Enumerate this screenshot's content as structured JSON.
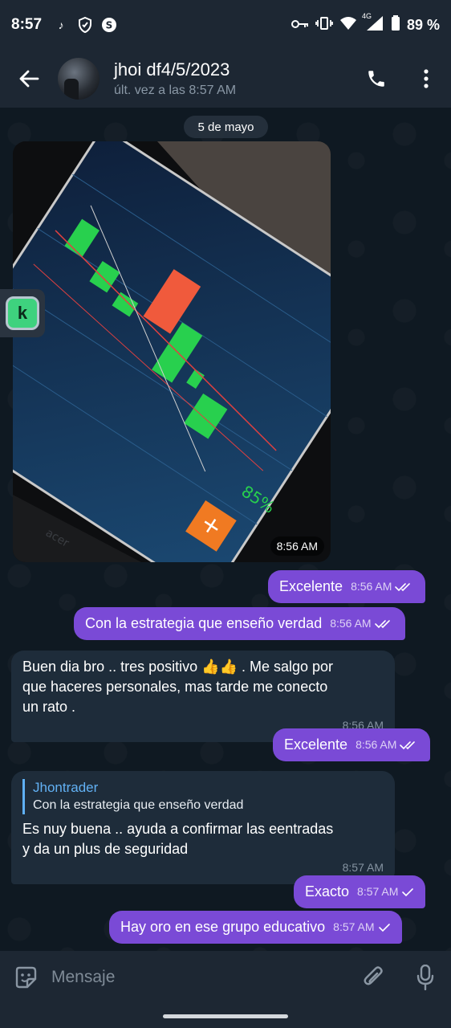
{
  "status_bar": {
    "time": "8:57",
    "network": "4G",
    "battery": "89 %"
  },
  "header": {
    "chat_name": "jhoi df4/5/2023",
    "last_seen": "últ. vez a las 8:57 AM"
  },
  "chat": {
    "date_label": "5 de mayo",
    "photo_time": "8:56 AM",
    "messages": [
      {
        "dir": "out",
        "text": "Excelente",
        "time": "8:56 AM"
      },
      {
        "dir": "out",
        "text": "Con la estrategia que enseño verdad",
        "time": "8:56 AM"
      },
      {
        "dir": "in",
        "text_line1": "Buen dia bro .. tres positivo 👍👍 . Me salgo por",
        "text_line2": "que haceres personales, mas tarde me conecto",
        "text_line3": "un rato .",
        "time": "8:56 AM"
      },
      {
        "dir": "out",
        "text": "Excelente",
        "time": "8:56 AM"
      },
      {
        "dir": "in",
        "reply_name": "Jhontrader",
        "reply_text": "Con la estrategia que enseño verdad",
        "text_line1": "Es nuy buena .. ayuda a confirmar las eentradas",
        "text_line2": "y da un plus de seguridad",
        "time": "8:57 AM"
      },
      {
        "dir": "out",
        "text": "Exacto",
        "time": "8:57 AM"
      },
      {
        "dir": "out",
        "text": "Hay oro en ese grupo educativo",
        "time": "8:57 AM"
      }
    ]
  },
  "input": {
    "placeholder": "Mensaje"
  },
  "photo_labels": {
    "pct": "85%",
    "plus": "+",
    "brand": "acer"
  },
  "k_app_letter": "k",
  "colors": {
    "outgoing_bubble": "#7a4ad6",
    "incoming_bubble": "#1e2c3a",
    "header_bg": "#1d2733",
    "reply_accent": "#62b1f4"
  }
}
